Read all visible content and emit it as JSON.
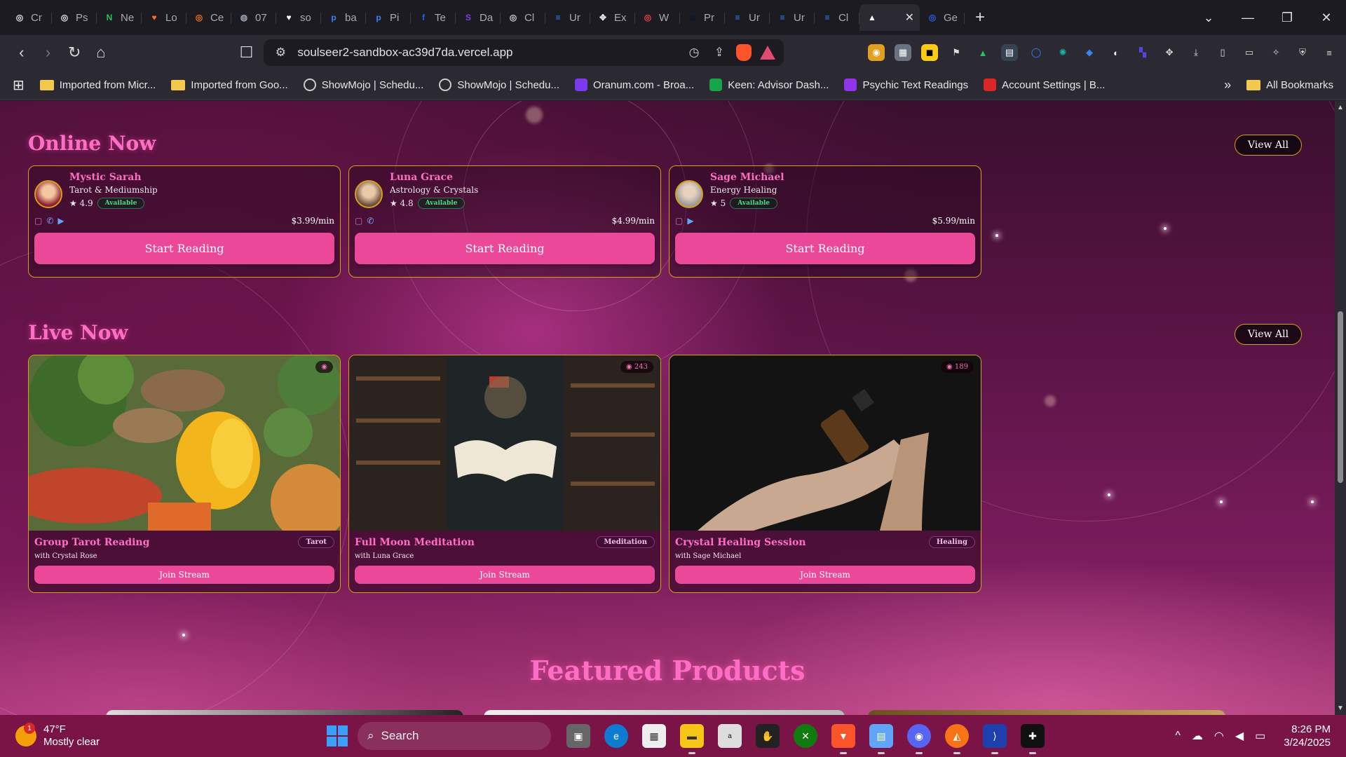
{
  "browser": {
    "tabs": [
      {
        "label": "Cr",
        "icon": "app-icon",
        "color": "#e5e7eb"
      },
      {
        "label": "Ps",
        "icon": "app-icon",
        "color": "#e5e7eb"
      },
      {
        "label": "Ne",
        "icon": "n-icon",
        "color": "#22c55e"
      },
      {
        "label": "Lo",
        "icon": "heart-icon",
        "color": "#f97316"
      },
      {
        "label": "Ce",
        "icon": "app-icon",
        "color": "#f97316"
      },
      {
        "label": "07",
        "icon": "globe-icon",
        "color": "#9ca3af"
      },
      {
        "label": "so",
        "icon": "heart-icon",
        "color": "#ffffff"
      },
      {
        "label": "ba",
        "icon": "p-icon",
        "color": "#3b82f6"
      },
      {
        "label": "Pi",
        "icon": "p-icon",
        "color": "#3b82f6"
      },
      {
        "label": "Te",
        "icon": "f-icon",
        "color": "#2563eb"
      },
      {
        "label": "Da",
        "icon": "s-icon",
        "color": "#7c3aed"
      },
      {
        "label": "Cl",
        "icon": "app-icon",
        "color": "#d1d5db"
      },
      {
        "label": "Ur",
        "icon": "doc-icon",
        "color": "#3b82f6"
      },
      {
        "label": "Ex",
        "icon": "puzzle-icon",
        "color": "#e5e7eb"
      },
      {
        "label": "W",
        "icon": "app-icon",
        "color": "#ef4444"
      },
      {
        "label": "Pr",
        "icon": "github-icon",
        "color": "#111827"
      },
      {
        "label": "Ur",
        "icon": "doc-icon",
        "color": "#3b82f6"
      },
      {
        "label": "Ur",
        "icon": "doc-icon",
        "color": "#3b82f6"
      },
      {
        "label": "Cl",
        "icon": "doc-icon",
        "color": "#3b82f6"
      },
      {
        "label": "",
        "icon": "vercel-icon",
        "color": "#ffffff",
        "active": true
      },
      {
        "label": "Ge",
        "icon": "app-icon",
        "color": "#2563eb"
      }
    ],
    "url": "soulseer2-sandbox-ac39d7da.vercel.app",
    "bookmarks": [
      {
        "label": "Imported from Micr...",
        "icon": "folder-icon"
      },
      {
        "label": "Imported from Goo...",
        "icon": "folder-icon"
      },
      {
        "label": "ShowMojo | Schedu...",
        "icon": "globe-icon"
      },
      {
        "label": "ShowMojo | Schedu...",
        "icon": "globe-icon"
      },
      {
        "label": "Oranum.com - Broa...",
        "icon": "oranum-icon"
      },
      {
        "label": "Keen: Advisor Dash...",
        "icon": "keen-icon"
      },
      {
        "label": "Psychic Text Readings",
        "icon": "psychic-icon"
      },
      {
        "label": "Account Settings | B...",
        "icon": "heart-icon"
      }
    ],
    "all_bookmarks": "All Bookmarks"
  },
  "online": {
    "title": "Online Now",
    "view_all": "View All",
    "readers": [
      {
        "name": "Mystic Sarah",
        "specialty": "Tarot & Mediumship",
        "rating": "★ 4.9",
        "status": "Available",
        "price": "$3.99/min",
        "cta": "Start Reading",
        "chat": true,
        "phone": true,
        "video": true
      },
      {
        "name": "Luna Grace",
        "specialty": "Astrology & Crystals",
        "rating": "★ 4.8",
        "status": "Available",
        "price": "$4.99/min",
        "cta": "Start Reading",
        "chat": true,
        "phone": true,
        "video": false
      },
      {
        "name": "Sage Michael",
        "specialty": "Energy Healing",
        "rating": "★ 5",
        "status": "Available",
        "price": "$5.99/min",
        "cta": "Start Reading",
        "chat": true,
        "phone": false,
        "video": true
      }
    ]
  },
  "live": {
    "title": "Live Now",
    "view_all": "View All",
    "streams": [
      {
        "title": "Group Tarot Reading",
        "host": "with Crystal Rose",
        "category": "Tarot",
        "viewers": "",
        "cta": "Join Stream",
        "thumb": "vegetables"
      },
      {
        "title": "Full Moon Meditation",
        "host": "with Luna Grace",
        "category": "Meditation",
        "viewers": "243",
        "cta": "Join Stream",
        "thumb": "library-book"
      },
      {
        "title": "Crystal Healing Session",
        "host": "with Sage Michael",
        "category": "Healing",
        "viewers": "189",
        "cta": "Join Stream",
        "thumb": "oil-bottle"
      }
    ]
  },
  "featured": {
    "title": "Featured Products"
  },
  "taskbar": {
    "temp": "47°F",
    "condition": "Mostly clear",
    "weather_badge": "1",
    "search_placeholder": "Search",
    "time": "8:26 PM",
    "date": "3/24/2025"
  },
  "colors": {
    "accent_pink": "#ec4899",
    "title_pink": "#ff6ec4",
    "gold_border": "#d4a017",
    "available_green": "#4ade80"
  }
}
